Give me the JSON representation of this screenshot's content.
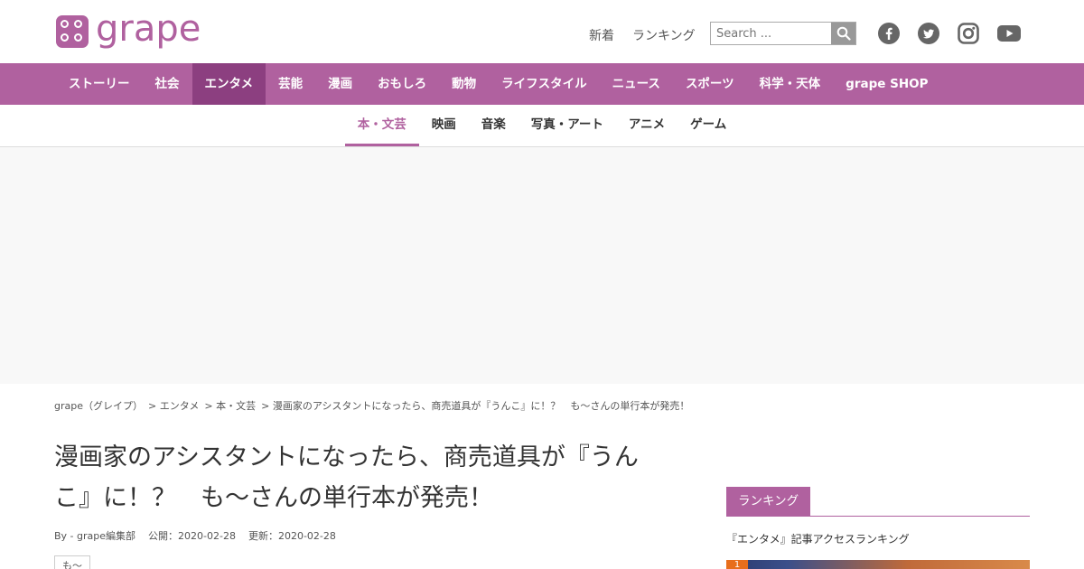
{
  "header": {
    "logo_text": "grape",
    "links": [
      "新着",
      "ランキング"
    ],
    "search_placeholder": "Search ...",
    "social": [
      "facebook-icon",
      "twitter-icon",
      "instagram-icon",
      "youtube-icon"
    ]
  },
  "main_nav": {
    "items": [
      "ストーリー",
      "社会",
      "エンタメ",
      "芸能",
      "漫画",
      "おもしろ",
      "動物",
      "ライフスタイル",
      "ニュース",
      "スポーツ",
      "科学・天体",
      "grape SHOP"
    ],
    "active": "エンタメ"
  },
  "sub_nav": {
    "items": [
      "本・文芸",
      "映画",
      "音楽",
      "写真・アート",
      "アニメ",
      "ゲーム"
    ],
    "active": "本・文芸"
  },
  "breadcrumb": {
    "items": [
      "grape（グレイプ）",
      "> エンタメ",
      "> 本・文芸",
      "> 漫画家のアシスタントになったら、商売道具が『うんこ』に！？　も～さんの単行本が発売！"
    ]
  },
  "article": {
    "title_line1": "漫画家のアシスタントになったら、商売道具が『うん",
    "title_line2": "こ』に！？　も～さんの単行本が発売！",
    "author": "By - grape編集部",
    "published": "公開：2020-02-28",
    "updated": "更新：2020-02-28",
    "tag": "も～"
  },
  "sidebar": {
    "ranking_tab": "ランキング",
    "ranking_subtitle": "『エンタメ』記事アクセスランキング",
    "first_rank": "1"
  },
  "colors": {
    "brand": "#b0619f",
    "nav_active": "#8c3f80",
    "rank_badge": "#e86e1c"
  }
}
